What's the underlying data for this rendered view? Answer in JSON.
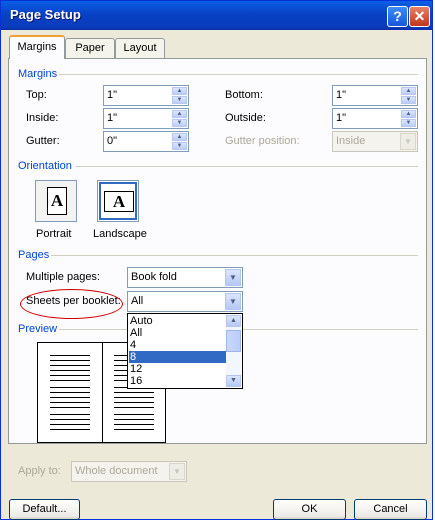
{
  "title": "Page Setup",
  "tabs": [
    "Margins",
    "Paper",
    "Layout"
  ],
  "margins": {
    "section": "Margins",
    "top": {
      "label": "Top:",
      "value": "1\""
    },
    "bottom": {
      "label": "Bottom:",
      "value": "1\""
    },
    "inside": {
      "label": "Inside:",
      "value": "1\""
    },
    "outside": {
      "label": "Outside:",
      "value": "1\""
    },
    "gutter": {
      "label": "Gutter:",
      "value": "0\""
    },
    "gutter_position": {
      "label": "Gutter position:",
      "value": "Inside"
    }
  },
  "orientation": {
    "section": "Orientation",
    "portrait": "Portrait",
    "landscape": "Landscape",
    "icon_letter": "A"
  },
  "pages": {
    "section": "Pages",
    "multiple_pages": {
      "label": "Multiple pages:",
      "value": "Book fold"
    },
    "sheets_per_booklet": {
      "label": "Sheets per booklet:",
      "value": "All",
      "options": [
        "Auto",
        "All",
        "4",
        "8",
        "12",
        "16"
      ],
      "selected": "8"
    }
  },
  "preview": {
    "section": "Preview"
  },
  "apply_to": {
    "label": "Apply to:",
    "value": "Whole document"
  },
  "buttons": {
    "default": "Default...",
    "ok": "OK",
    "cancel": "Cancel"
  },
  "titlebar_buttons": {
    "help": "?",
    "close": "✕"
  },
  "colors": {
    "titlebar": "#0a5fe6",
    "section": "#0046d5",
    "selection": "#316ac5",
    "highlight_oval": "#d00000"
  }
}
